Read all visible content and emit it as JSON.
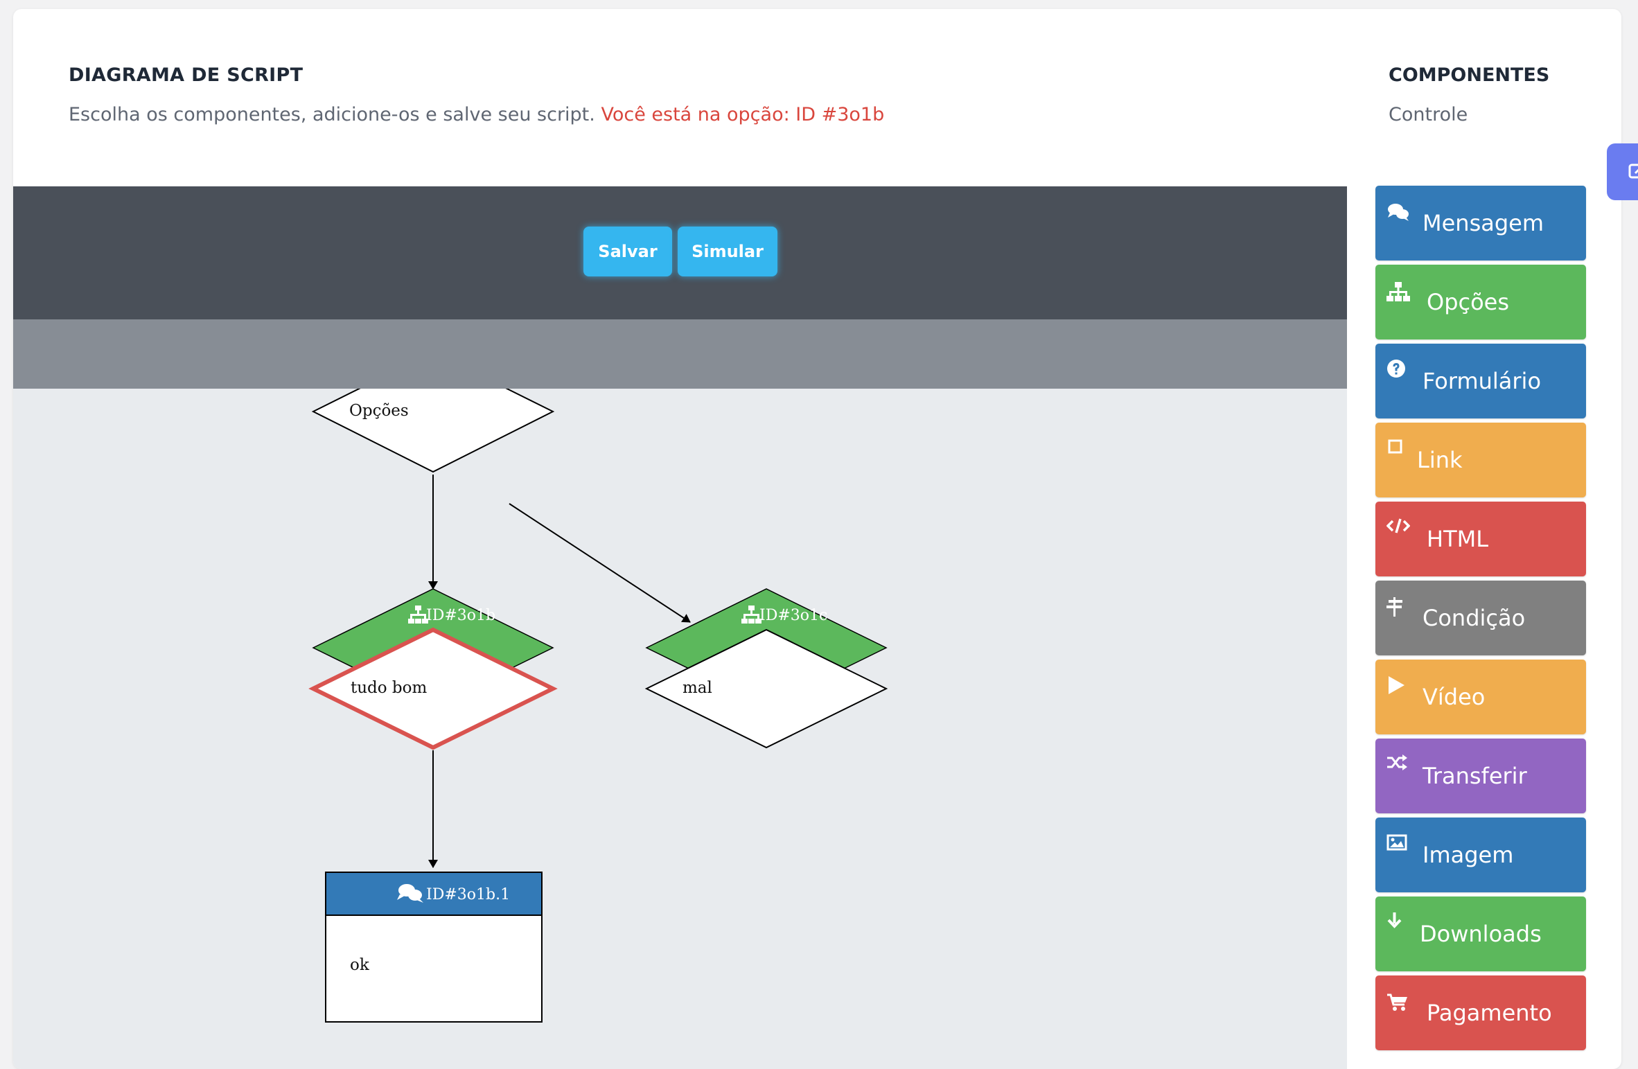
{
  "header": {
    "title": "DIAGRAMA DE SCRIPT",
    "subtitle": "Escolha os componentes, adicione-os e salve seu script.",
    "current_option": "Você está na opção: ID #3o1b"
  },
  "components_panel": {
    "title": "COMPONENTES",
    "subtitle": "Controle",
    "items": [
      {
        "label": "Mensagem",
        "icon": "comments-icon",
        "color": "#337ab7"
      },
      {
        "label": "Opções",
        "icon": "sitemap-icon",
        "color": "#5cb85c"
      },
      {
        "label": "Formulário",
        "icon": "question-circle-icon",
        "color": "#337ab7"
      },
      {
        "label": "Link",
        "icon": "square-outline-icon",
        "color": "#f0ad4e"
      },
      {
        "label": "HTML",
        "icon": "code-icon",
        "color": "#d9534f"
      },
      {
        "label": "Condição",
        "icon": "signpost-icon",
        "color": "#808080"
      },
      {
        "label": "Vídeo",
        "icon": "play-icon",
        "color": "#f0ad4e"
      },
      {
        "label": "Transferir",
        "icon": "shuffle-icon",
        "color": "#9266c2"
      },
      {
        "label": "Imagem",
        "icon": "image-icon",
        "color": "#337ab7"
      },
      {
        "label": "Downloads",
        "icon": "download-icon",
        "color": "#5cb85c"
      },
      {
        "label": "Pagamento",
        "icon": "cart-icon",
        "color": "#d9534f"
      }
    ]
  },
  "toolbar": {
    "save_label": "Salvar",
    "simulate_label": "Simular",
    "accent": "#35b6ef"
  },
  "diagram": {
    "root": {
      "label": "Opções"
    },
    "option_a": {
      "id": "ID#3o1b",
      "label": "tudo bom",
      "selected": true
    },
    "option_b": {
      "id": "ID#3o1c",
      "label": "mal",
      "selected": false
    },
    "message": {
      "id": "ID#3o1b.1",
      "label": "ok"
    },
    "colors": {
      "option_header": "#5cb85c",
      "message_header": "#337ab7",
      "selected_border": "#d9534f"
    }
  }
}
